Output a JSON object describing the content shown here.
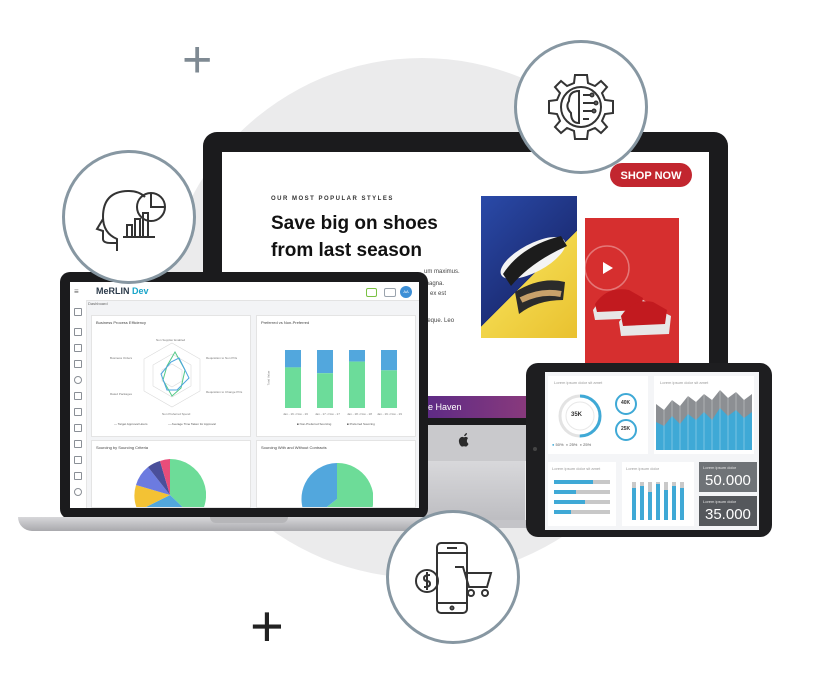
{
  "imac": {
    "eyebrow": "OUR MOST POPULAR STYLES",
    "headline": "Save big on shoes from last season",
    "body_fragments": [
      "um maximus.",
      "magna.",
      "si ex est",
      "neque. Leo"
    ],
    "shop_button": "SHOP NOW",
    "strip_text": "e Haven",
    "logo_glyph": ""
  },
  "laptop": {
    "brand_main": "MeRLIN",
    "brand_accent": "Dev",
    "breadcrumb": "Dashboard",
    "avatar": "AA",
    "cards": [
      {
        "title": "Business Process Efficiency"
      },
      {
        "title": "Preferred vs Non-Preferred"
      },
      {
        "title": "Sourcing by Sourcing Criteria"
      },
      {
        "title": "Sourcing With and Without Contracts"
      }
    ],
    "radar_labels": [
      "Non Supplier Enabled",
      "Requisition to Non POs",
      "Requisition to Change POs",
      "Non Preferred Spend",
      "Rated Packages",
      "Business Orders"
    ],
    "radar_legend": [
      "Target Approval Hours",
      "Average Time Taken for Approval"
    ],
    "bar_legend": [
      "Non-Preferred Sourcing",
      "Preferred Sourcing"
    ],
    "bar_y_label": "Total Value",
    "bar_x_labels": [
      "Jan - 16 • Nov - 16",
      "Jan - 17 • Nov - 17",
      "Jan - 18 • Nov - 18",
      "Jan - 19 • Nov - 19"
    ],
    "bar_values": [
      {
        "preferred": 0.7,
        "non_preferred": 0.3
      },
      {
        "preferred": 0.6,
        "non_preferred": 0.4
      },
      {
        "preferred": 0.8,
        "non_preferred": 0.2
      },
      {
        "preferred": 0.65,
        "non_preferred": 0.35
      }
    ],
    "colors": {
      "preferred": "#6cdc9a",
      "non_preferred": "#52a7dd"
    }
  },
  "tablet": {
    "panel_label": "Lorem ipsum dolor sit amet",
    "gauges": [
      "35K",
      "40K",
      "25K"
    ],
    "gauge_legend": [
      "50%",
      "25%",
      "25%"
    ],
    "stat_label": "Lorem ipsum dolor",
    "stats": [
      "50.000",
      "35.000"
    ]
  }
}
